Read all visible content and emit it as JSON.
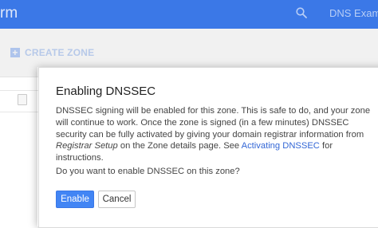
{
  "header": {
    "brand_fragment": "rm",
    "search_text": "DNS Examp"
  },
  "toolbar": {
    "create_zone_label": "CREATE ZONE"
  },
  "dialog": {
    "title": "Enabling DNSSEC",
    "body_part1": "DNSSEC signing will be enabled for this zone. This is safe to do, and your zone will continue to work. Once the zone is signed (in a few minutes) DNSSEC security can be fully activated by giving your domain registrar information from ",
    "body_italic": "Registrar Setup",
    "body_part2": " on the Zone details page. See ",
    "body_link": "Activating DNSSEC",
    "body_part3": " for instructions.",
    "question": "Do you want to enable DNSSEC on this zone?",
    "enable_label": "Enable",
    "cancel_label": "Cancel"
  },
  "colors": {
    "header_bg": "#3b78e7",
    "primary_button": "#4285f4",
    "link": "#3367d6"
  }
}
